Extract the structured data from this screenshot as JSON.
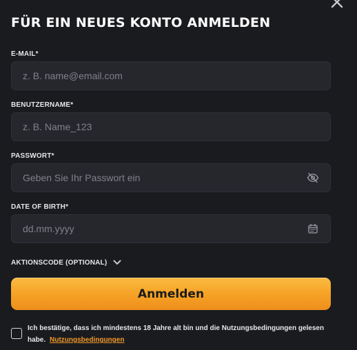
{
  "modal": {
    "title": "FÜR EIN NEUES KONTO ANMELDEN",
    "close_icon": "close-icon"
  },
  "fields": {
    "email": {
      "label": "E-MAIL*",
      "placeholder": "z. B. name@email.com",
      "value": ""
    },
    "username": {
      "label": "BENUTZERNAME*",
      "placeholder": "z. B. Name_123",
      "value": ""
    },
    "password": {
      "label": "PASSWORT*",
      "placeholder": "Geben Sie Ihr Passwort ein",
      "value": "",
      "icon": "eye-off-icon"
    },
    "dob": {
      "label": "DATE OF BIRTH*",
      "placeholder": "dd.mm.yyyy",
      "value": "",
      "icon": "calendar-icon"
    }
  },
  "promo": {
    "label": "AKTIONSCODE (OPTIONAL)",
    "icon": "chevron-down-icon"
  },
  "submit": {
    "label": "Anmelden"
  },
  "terms": {
    "text": "Ich bestätige, dass ich mindestens 18 Jahre alt bin und die Nutzungsbedingungen gelesen habe.",
    "link": "Nutzungsbedingungen",
    "checked": false
  },
  "colors": {
    "background": "#1a1b1f",
    "field_bg": "#26272d",
    "accent": "#f5a124",
    "link": "#f29a2a"
  }
}
